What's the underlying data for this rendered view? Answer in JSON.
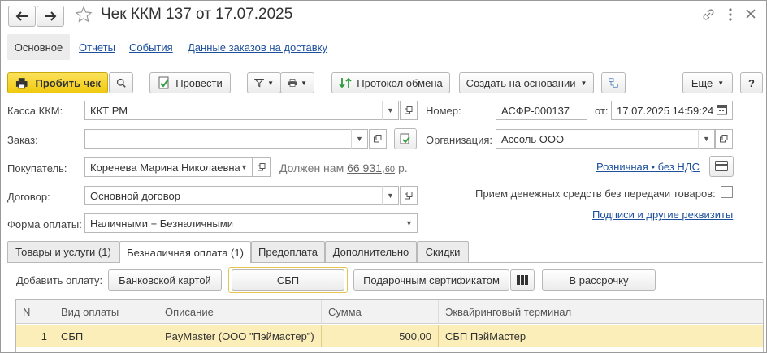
{
  "window": {
    "title": "Чек ККМ 137 от 17.07.2025"
  },
  "nav_tabs": [
    "Основное",
    "Отчеты",
    "События",
    "Данные заказов на доставку"
  ],
  "toolbar": {
    "punch": "Пробить чек",
    "post": "Провести",
    "exchange": "Протокол обмена",
    "create_based": "Создать на основании",
    "more": "Еще",
    "help": "?"
  },
  "form": {
    "kassa_label": "Касса ККМ:",
    "kassa_value": "ККТ РМ",
    "number_label": "Номер:",
    "number_value": "АСФР-000137",
    "date_label": "от:",
    "date_value": "17.07.2025 14:59:24",
    "order_label": "Заказ:",
    "order_value": "",
    "org_label": "Организация:",
    "org_value": "Ассоль ООО",
    "buyer_label": "Покупатель:",
    "buyer_value": "Коренева Марина Николаевна",
    "debt_prefix": "Должен нам",
    "debt_int": "66 931,",
    "debt_frac": "60",
    "debt_suffix": "р.",
    "price_link": "Розничная • без НДС",
    "contract_label": "Договор:",
    "contract_value": "Основной договор",
    "noreceipt_label": "Прием денежных средств без передачи товаров:",
    "sign_link": "Подписи и другие реквизиты",
    "payform_label": "Форма оплаты:",
    "payform_value": "Наличными + Безналичными"
  },
  "doc_tabs": [
    "Товары и услуги (1)",
    "Безналичная оплата (1)",
    "Предоплата",
    "Дополнительно",
    "Скидки"
  ],
  "payment": {
    "add_label": "Добавить оплату:",
    "card": "Банковской картой",
    "sbp": "СБП",
    "gift": "Подарочным сертификатом",
    "installment": "В рассрочку"
  },
  "table": {
    "headers": [
      "N",
      "Вид оплаты",
      "Описание",
      "Сумма",
      "Эквайринговый терминал"
    ],
    "rows": [
      [
        "1",
        "СБП",
        "PayMaster (ООО \"Пэймастер\")",
        "500,00",
        "СБП ПэйМастер"
      ]
    ]
  },
  "colors": {
    "punch_button": "#f5d327",
    "selected_row": "#fbeeb8",
    "link": "#1c4f9c"
  }
}
